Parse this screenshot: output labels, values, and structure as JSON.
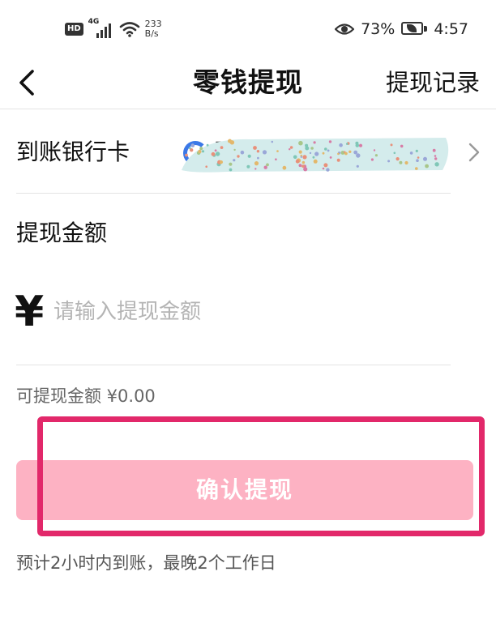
{
  "status_bar": {
    "hd_badge": "HD",
    "network_type": "4G",
    "net_speed_value": "233",
    "net_speed_unit": "B/s",
    "battery_percent": "73%",
    "time": "4:57",
    "icons": [
      "hd-icon",
      "signal-icon",
      "wifi-icon",
      "eye-icon",
      "battery-icon"
    ]
  },
  "nav": {
    "back_icon": "chevron-left-icon",
    "title": "零钱提现",
    "history_link": "提现记录"
  },
  "bank": {
    "label": "到账银行卡",
    "bank_name": "张",
    "redacted": true,
    "chevron_icon": "chevron-right-icon"
  },
  "amount": {
    "label": "提现金额",
    "currency_symbol": "¥",
    "placeholder": "请输入提现金额",
    "value": ""
  },
  "available": {
    "text": "可提现金额 ¥0.00"
  },
  "confirm": {
    "label": "确认提现",
    "enabled": false,
    "color": "#fdb2c3"
  },
  "note": {
    "text": "预计2小时内到账，最晚2个工作日"
  },
  "annotation": {
    "highlight_color": "#e2286a"
  }
}
